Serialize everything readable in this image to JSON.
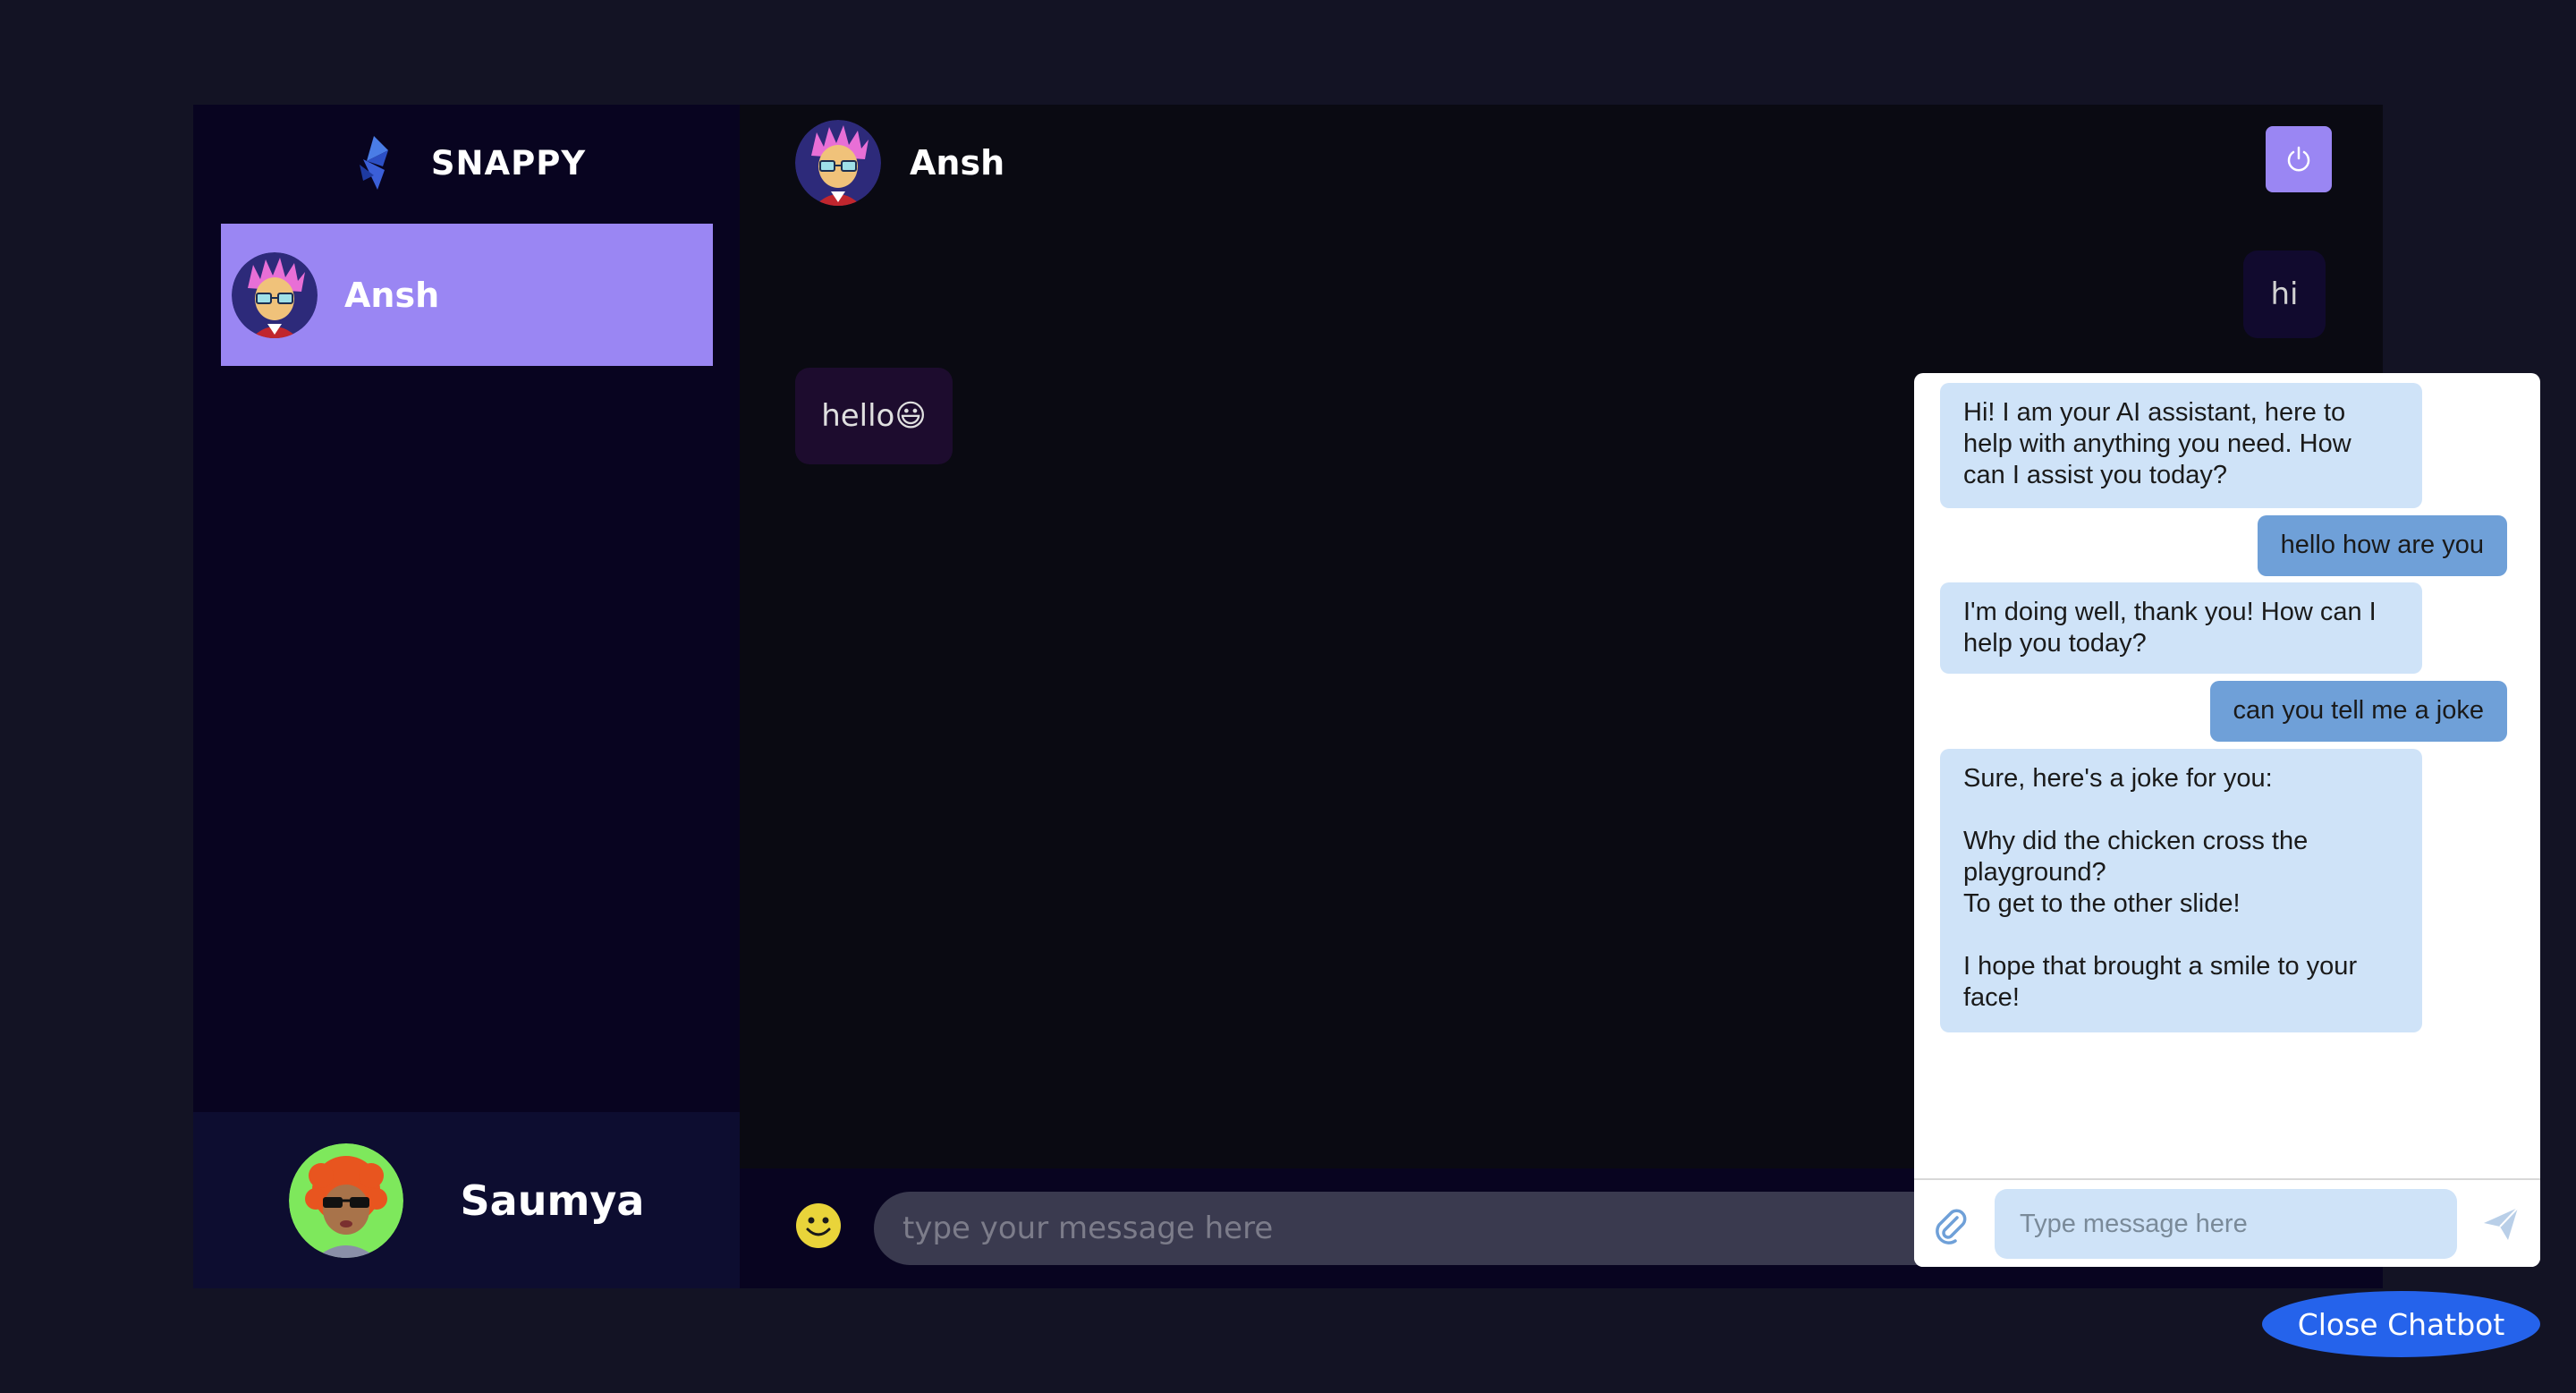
{
  "brand": {
    "name": "SNAPPY",
    "logo_icon": "snappy-logo-icon"
  },
  "contacts": [
    {
      "name": "Ansh",
      "selected": true
    }
  ],
  "current_user": {
    "name": "Saumya"
  },
  "chat": {
    "header_name": "Ansh",
    "logout_icon": "power-icon",
    "messages": [
      {
        "direction": "sent",
        "text": "hi"
      },
      {
        "direction": "received",
        "text": "hello😃"
      }
    ],
    "input_placeholder": "type your message here",
    "emoji_icon": "smiley-icon"
  },
  "chatbot": {
    "messages": [
      {
        "role": "bot",
        "text": "Hi! I am your AI assistant, here to help with anything you need. How can I assist you today?"
      },
      {
        "role": "user",
        "text": "hello how are you"
      },
      {
        "role": "bot",
        "text": "I'm doing well, thank you! How can I help you today?"
      },
      {
        "role": "user",
        "text": "can you tell me a joke"
      },
      {
        "role": "bot",
        "text": "Sure, here's a joke for you:\n\nWhy did the chicken cross the playground?\nTo get to the other slide!\n\nI hope that brought a smile to your face!"
      }
    ],
    "input_placeholder": "Type message here",
    "attach_icon": "paperclip-icon",
    "send_icon": "send-icon",
    "close_label": "Close Chatbot"
  },
  "colors": {
    "accent": "#9a86f3",
    "background": "#131324",
    "panel": "#080420",
    "bot_bubble": "#cfe3f8",
    "user_bubble": "#6fa0d8",
    "close_button": "#2563eb"
  }
}
